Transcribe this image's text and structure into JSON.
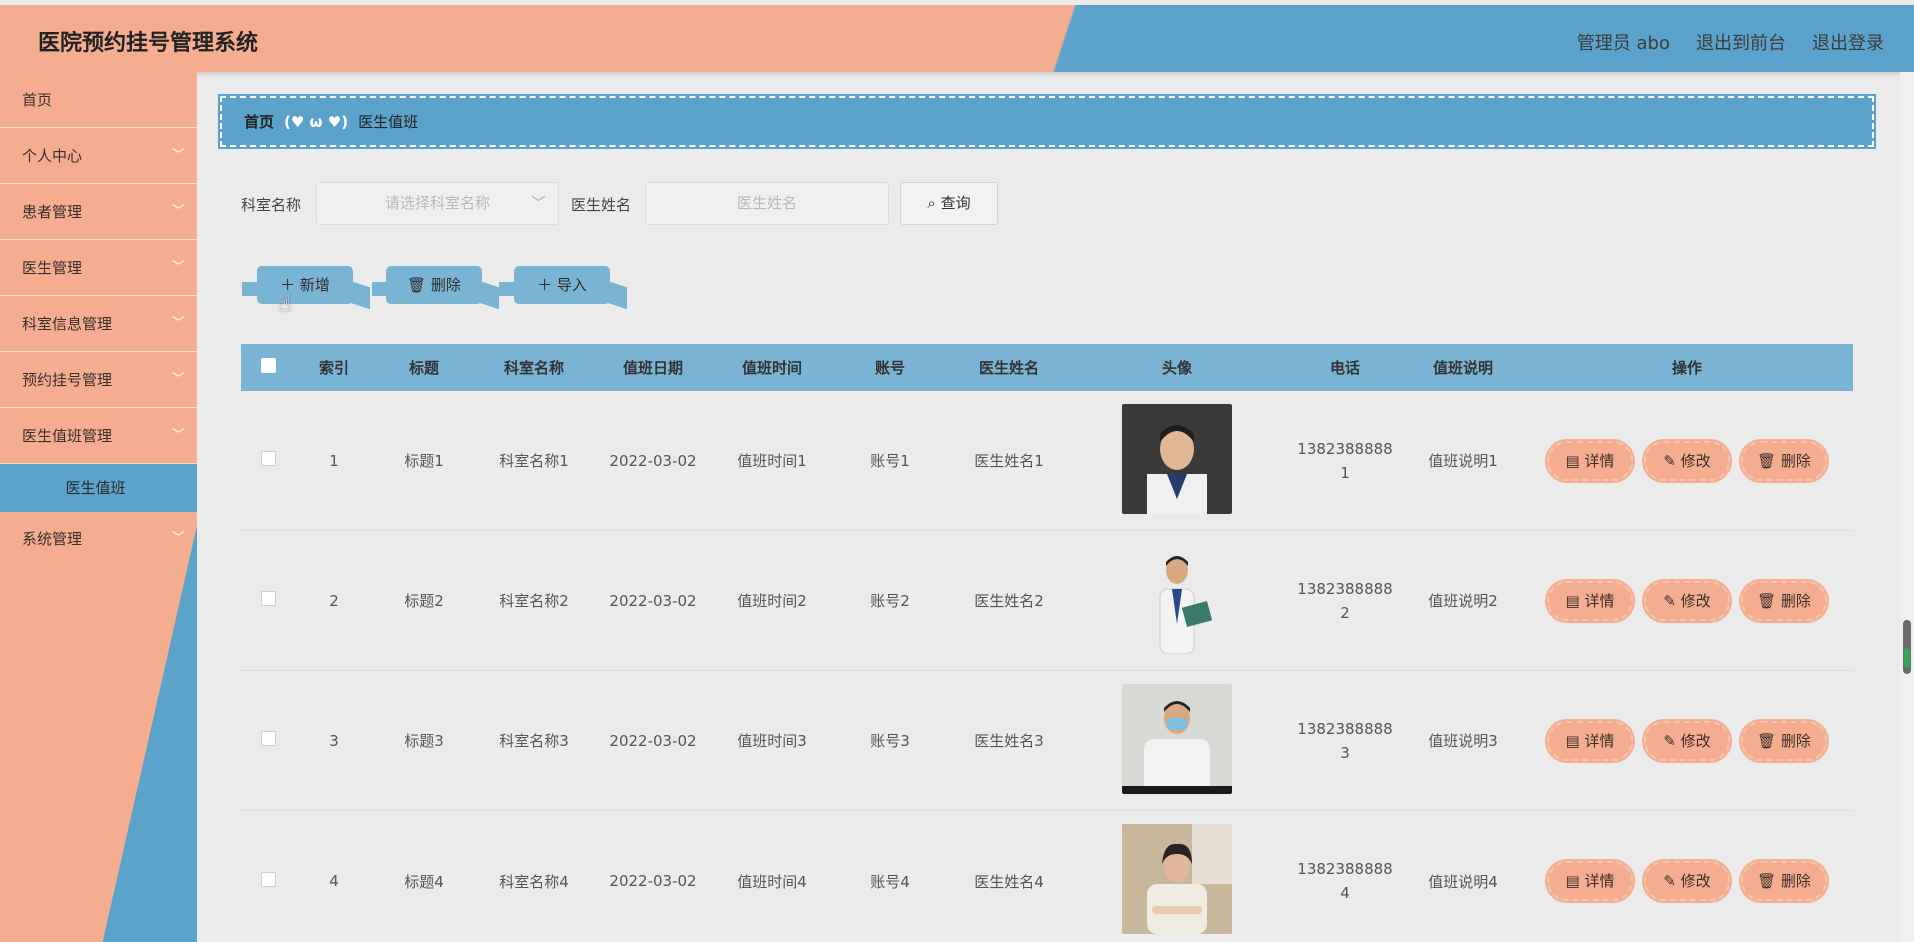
{
  "header": {
    "title": "医院预约挂号管理系统",
    "user": "管理员 abo",
    "front": "退出到前台",
    "logout": "退出登录"
  },
  "sidebar": {
    "items": [
      {
        "label": "首页"
      },
      {
        "label": "个人中心"
      },
      {
        "label": "患者管理"
      },
      {
        "label": "医生管理"
      },
      {
        "label": "科室信息管理"
      },
      {
        "label": "预约挂号管理"
      },
      {
        "label": "医生值班管理"
      },
      {
        "label": "医生值班"
      },
      {
        "label": "系统管理"
      }
    ]
  },
  "breadcrumb": {
    "home": "首页",
    "sep": "(♥ ω ♥)",
    "current": "医生值班"
  },
  "search": {
    "dept_label": "科室名称",
    "dept_placeholder": "请选择科室名称",
    "doctor_label": "医生姓名",
    "doctor_placeholder": "医生姓名",
    "query": "查询"
  },
  "actions": {
    "add": "新增",
    "delete": "删除",
    "import": "导入"
  },
  "table": {
    "columns": [
      "索引",
      "标题",
      "科室名称",
      "值班日期",
      "值班时间",
      "账号",
      "医生姓名",
      "头像",
      "电话",
      "值班说明",
      "操作"
    ],
    "ops": {
      "detail": "详情",
      "edit": "修改",
      "delete": "删除"
    },
    "rows": [
      {
        "index": "1",
        "title": "标题1",
        "dept": "科室名称1",
        "date": "2022-03-02",
        "time": "值班时间1",
        "account": "账号1",
        "doctor": "医生姓名1",
        "phone1": "1382388888",
        "phone2": "1",
        "note": "值班说明1"
      },
      {
        "index": "2",
        "title": "标题2",
        "dept": "科室名称2",
        "date": "2022-03-02",
        "time": "值班时间2",
        "account": "账号2",
        "doctor": "医生姓名2",
        "phone1": "1382388888",
        "phone2": "2",
        "note": "值班说明2"
      },
      {
        "index": "3",
        "title": "标题3",
        "dept": "科室名称3",
        "date": "2022-03-02",
        "time": "值班时间3",
        "account": "账号3",
        "doctor": "医生姓名3",
        "phone1": "1382388888",
        "phone2": "3",
        "note": "值班说明3"
      },
      {
        "index": "4",
        "title": "标题4",
        "dept": "科室名称4",
        "date": "2022-03-02",
        "time": "值班时间4",
        "account": "账号4",
        "doctor": "医生姓名4",
        "phone1": "1382388888",
        "phone2": "4",
        "note": "值班说明4"
      }
    ]
  },
  "colors": {
    "salmon": "#f5ad8f",
    "blue": "#5ba3cb",
    "light_blue": "#7ab4d5",
    "background": "#ebebeb"
  }
}
